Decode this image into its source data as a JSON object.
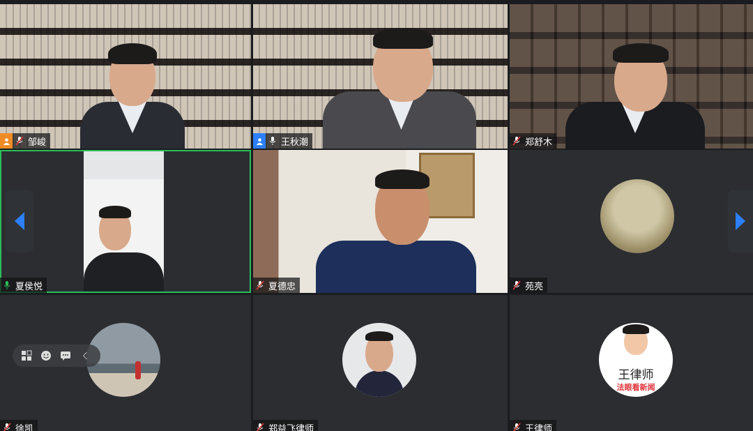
{
  "participants": [
    {
      "name": "邹峻",
      "host": true,
      "host_color": "#f08a24",
      "mic": "muted"
    },
    {
      "name": "王秋潮",
      "host": true,
      "host_color": "#2d7ff9",
      "mic": "on"
    },
    {
      "name": "郑舒木",
      "mic": "muted"
    },
    {
      "name": "夏侯悦",
      "mic": "speaking"
    },
    {
      "name": "夏德忠",
      "mic": "muted"
    },
    {
      "name": "苑亮",
      "mic": "muted"
    },
    {
      "name": "徐凯",
      "mic": "muted"
    },
    {
      "name": "郑益飞律师",
      "mic": "muted"
    },
    {
      "name": "王律师",
      "mic": "muted"
    }
  ],
  "avatar_text": {
    "law_title": "王律师",
    "law_sub": "法眼看新闻"
  },
  "colors": {
    "active_border": "#2bbf5b",
    "nav_arrow": "#2d7ff9",
    "muted_icon": "#ffffff"
  },
  "icons": [
    "mic-muted-icon",
    "mic-icon",
    "host-icon",
    "chevron-left-icon",
    "chevron-right-icon",
    "grid-view-icon",
    "emoji-icon",
    "chat-icon"
  ]
}
